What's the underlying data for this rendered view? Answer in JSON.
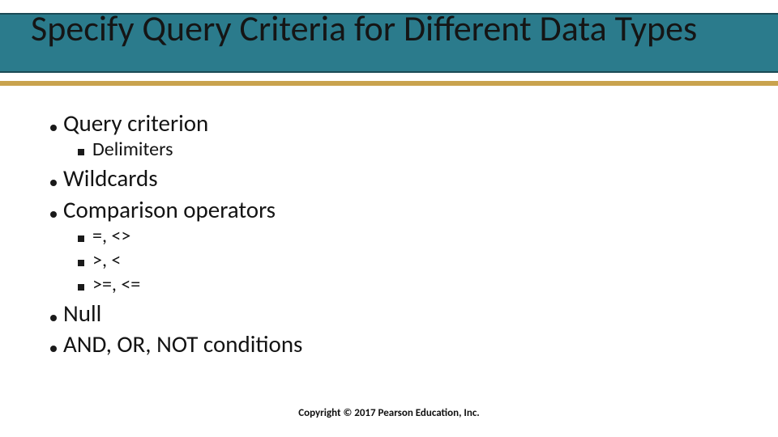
{
  "title": "Specify Query Criteria for Different Data Types",
  "bullets": {
    "b1": "Query criterion",
    "b1_1": "Delimiters",
    "b2": "Wildcards",
    "b3": "Comparison operators",
    "b3_1": "=, <>",
    "b3_2": ">, <",
    "b3_3": ">=, <=",
    "b4": "Null",
    "b5": "AND, OR, NOT conditions"
  },
  "footer": "Copyright © 2017 Pearson Education, Inc."
}
